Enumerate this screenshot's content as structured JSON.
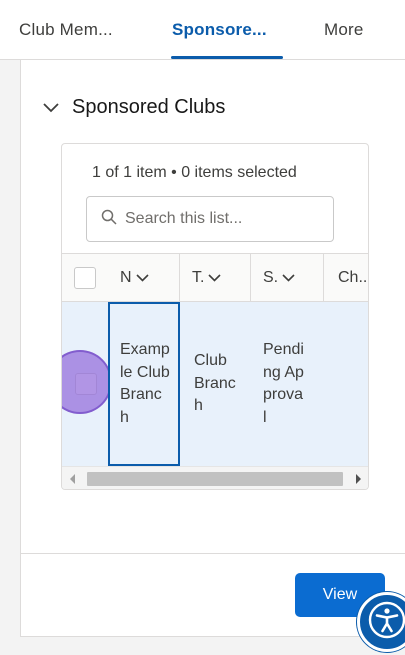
{
  "tabs": {
    "tab1": "Club Mem...",
    "tab2": "Sponsore...",
    "tab3": "More"
  },
  "section": {
    "title": "Sponsored Clubs"
  },
  "list": {
    "meta": "1 of 1 item • 0 items selected",
    "search_placeholder": "Search this list...",
    "columns": {
      "n": "N",
      "t": "T.",
      "s": "S.",
      "c": "Ch.."
    },
    "row": {
      "name": "Example Club Branch",
      "type": "Club Branch",
      "status": "Pending Approval"
    }
  },
  "actions": {
    "view_label": "View"
  },
  "colors": {
    "brand": "#0b5cab",
    "button": "#0b6cd1",
    "row_highlight": "#e8f1fb",
    "click_marker": "#936cdb"
  },
  "icons": {
    "collapse": "chevron-down-icon",
    "search": "search-icon",
    "sort": "chevron-down-icon",
    "accessibility": "accessibility-icon"
  }
}
